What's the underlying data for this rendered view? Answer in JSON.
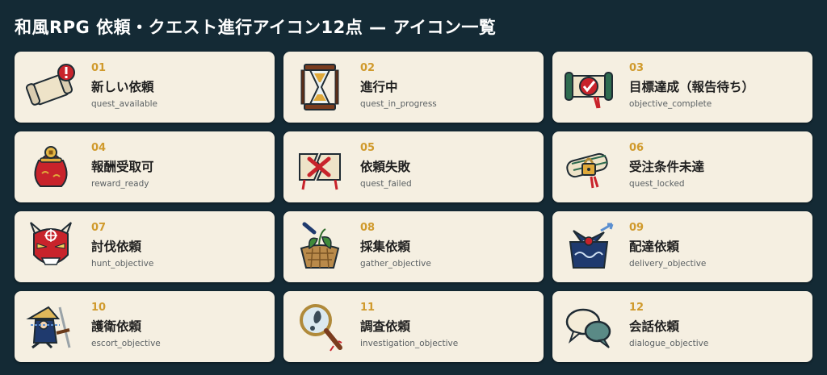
{
  "page": {
    "title": "和風RPG 依頼・クエスト進行アイコン12点 — アイコン一覧"
  },
  "cards": [
    {
      "num": "01",
      "name": "新しい依頼",
      "code": "quest_available",
      "icon": "scroll-exclamation-icon"
    },
    {
      "num": "02",
      "name": "進行中",
      "code": "quest_in_progress",
      "icon": "hourglass-icon"
    },
    {
      "num": "03",
      "name": "目標達成（報告待ち）",
      "code": "objective_complete",
      "icon": "scroll-checkmark-icon"
    },
    {
      "num": "04",
      "name": "報酬受取可",
      "code": "reward_ready",
      "icon": "reward-pouch-icon"
    },
    {
      "num": "05",
      "name": "依頼失敗",
      "code": "quest_failed",
      "icon": "torn-scroll-x-icon"
    },
    {
      "num": "06",
      "name": "受注条件未達",
      "code": "quest_locked",
      "icon": "scroll-padlock-icon"
    },
    {
      "num": "07",
      "name": "討伐依頼",
      "code": "hunt_objective",
      "icon": "oni-mask-target-icon"
    },
    {
      "num": "08",
      "name": "採集依頼",
      "code": "gather_objective",
      "icon": "herb-basket-icon"
    },
    {
      "num": "09",
      "name": "配達依頼",
      "code": "delivery_objective",
      "icon": "furoshiki-bundle-icon"
    },
    {
      "num": "10",
      "name": "護衛依頼",
      "code": "escort_objective",
      "icon": "traveler-sword-icon"
    },
    {
      "num": "11",
      "name": "調査依頼",
      "code": "investigation_objective",
      "icon": "magnifier-footprint-icon"
    },
    {
      "num": "12",
      "name": "会話依頼",
      "code": "dialogue_objective",
      "icon": "speech-bubbles-icon"
    }
  ]
}
